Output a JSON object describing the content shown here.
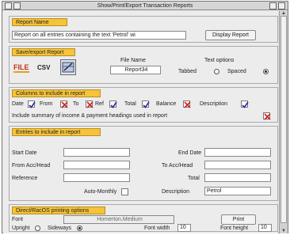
{
  "window": {
    "title": "Show/Print/Export Transaction Reports"
  },
  "report_name": {
    "header": "Report Name",
    "value": "Report on all entries containing the text 'Petrol' wi",
    "display_button": "Display Report"
  },
  "save_export": {
    "header": "Save/export Report",
    "icons": {
      "file": "FILE",
      "csv": "CSV"
    },
    "file_name_label": "File Name",
    "file_name_value": "Report34",
    "text_options_label": "Text options",
    "tabbed_label": "Tabbed",
    "spaced_label": "Spaced",
    "selected_option": "spaced"
  },
  "columns": {
    "header": "Columns to include in report",
    "items": [
      {
        "label": "Date",
        "checked": true,
        "style": "tick"
      },
      {
        "label": "From",
        "checked": true,
        "style": "cross"
      },
      {
        "label": "To",
        "checked": true,
        "style": "cross"
      },
      {
        "label": "Ref",
        "checked": true,
        "style": "tick"
      },
      {
        "label": "Total",
        "checked": true,
        "style": "tick"
      },
      {
        "label": "Balance",
        "checked": true,
        "style": "cross"
      },
      {
        "label": "Description",
        "checked": true,
        "style": "tick"
      }
    ],
    "summary_label": "Include summary of income & payment headings used in report",
    "summary_checked": true
  },
  "entries": {
    "header": "Entries to include in report",
    "start_date_label": "Start Date",
    "start_date_value": "",
    "end_date_label": "End Date",
    "end_date_value": "",
    "from_label": "From Acc/Head",
    "from_value": "",
    "to_label": "To Acc/Head",
    "to_value": "",
    "reference_label": "Reference",
    "reference_value": "",
    "total_label": "Total",
    "total_value": "",
    "auto_monthly_label": "Auto-Monthly",
    "description_label": "Description",
    "description_value": "Petrol"
  },
  "printing": {
    "header": "Direct/RacOS printing options",
    "font_label": "Font",
    "font_value": "Homerton.Medium",
    "print_button": "Print",
    "upright_label": "Upright",
    "sideways_label": "Sideways",
    "orientation": "sideways",
    "font_width_label": "Font width",
    "font_width_value": "10",
    "font_height_label": "Font height",
    "font_height_value": "10"
  },
  "colors": {
    "header_bg": "#f6c33a",
    "cross": "#d02020",
    "tick": "#2a2aa0"
  }
}
